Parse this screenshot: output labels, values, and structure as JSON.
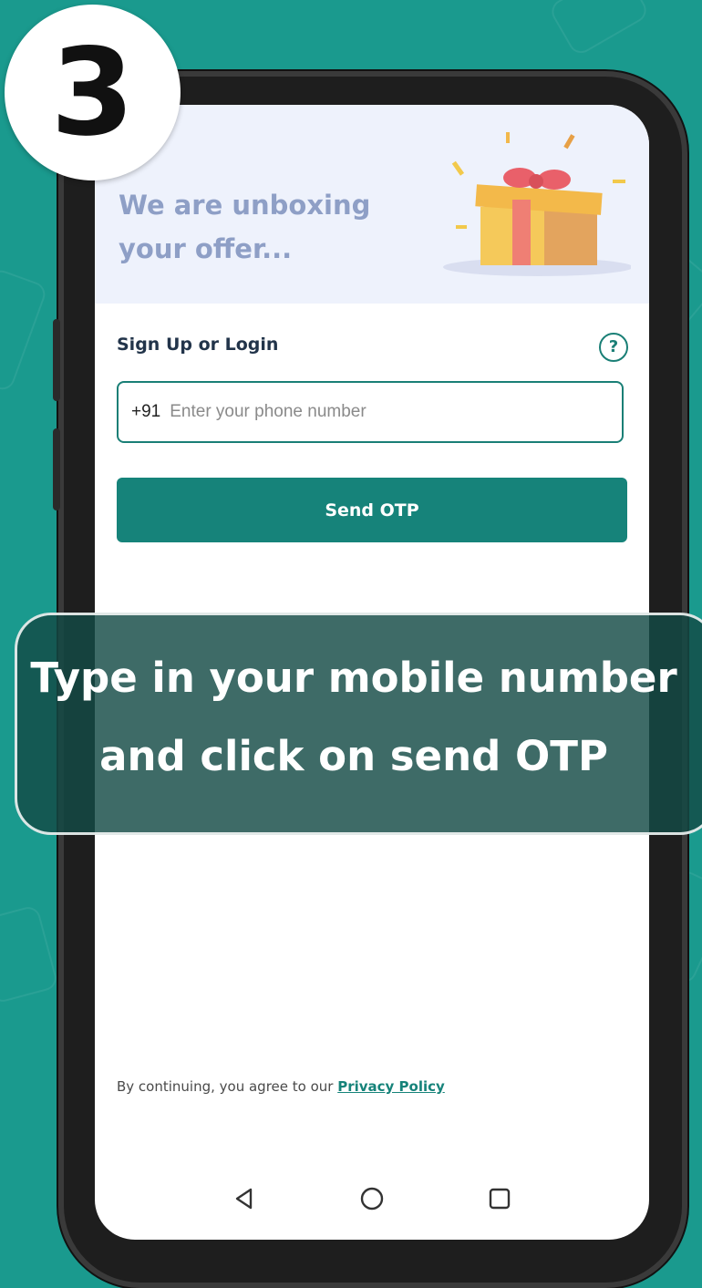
{
  "step_badge": {
    "number": "3"
  },
  "hero": {
    "title_line1": "We are unboxing",
    "title_line2": "your offer...",
    "image": "gift-box-illustration"
  },
  "signup": {
    "heading": "Sign Up or Login",
    "help_icon": "question-circle-icon",
    "country_code": "+91",
    "phone_placeholder": "Enter your phone number",
    "phone_value": "",
    "send_button": "Send OTP"
  },
  "footer": {
    "agree_text": "By continuing, you agree to our ",
    "privacy_link": "Privacy Policy"
  },
  "navbar": {
    "back": "triangle-back-icon",
    "home": "circle-home-icon",
    "recents": "square-recents-icon"
  },
  "banner": {
    "line1": "Type in your mobile number",
    "line2": "and click on send OTP"
  },
  "colors": {
    "background": "#1a9a8e",
    "accent": "#16837a",
    "hero_bg": "#eef2fc",
    "hero_text": "#8e9fc6",
    "banner_bg": "#134a46"
  }
}
